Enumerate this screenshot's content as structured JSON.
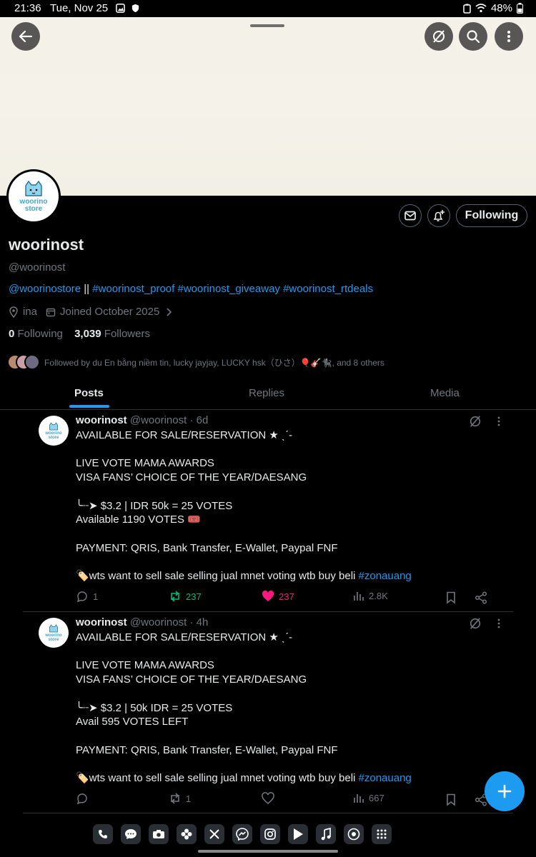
{
  "status_bar": {
    "time": "21:36",
    "date": "Tue, Nov 25",
    "battery": "48%"
  },
  "profile": {
    "display_name": "woorinost",
    "handle": "@woorinost",
    "avatar_text": [
      "woorino",
      "store"
    ],
    "bio": {
      "link1": "@woorinostore",
      "sep": " || ",
      "link2": "#woorinost_proof",
      "link3": "#woorinost_giveaway",
      "link4": "#woorinost_rtdeals"
    },
    "location": "ina",
    "joined": "Joined October 2025",
    "following_count": "0",
    "following_label": "Following",
    "followers_count": "3,039",
    "followers_label": "Followers",
    "followed_by": "Followed by du En bằng niềm tin, lucky jayjay, LUCKY hsk（ひさ）🎈🎸🐈‍⬛, and 8 others",
    "follow_button": "Following"
  },
  "tabs": [
    "Posts",
    "Replies",
    "Media"
  ],
  "posts": [
    {
      "name": "woorinost",
      "handle": "@woorinost",
      "time": "· 6d",
      "body": "AVAILABLE FOR SALE/RESERVATION ★ ˎˊ-\n\nLIVE VOTE MAMA AWARDS\nVISA FANS’ CHOICE OF THE YEAR/DAESANG\n\n╰┈➤ $3.2 | IDR 50k = 25 VOTES\nAvailable 1190 VOTES 🎟️\n\nPAYMENT: QRIS, Bank Transfer, E-Wallet, Paypal FNF\n\n🏷️wts want to sell sale selling jual mnet voting wtb buy beli ",
      "hashtag": "#zonauang",
      "replies": "1",
      "reposts": "237",
      "likes": "237",
      "views": "2.8K"
    },
    {
      "name": "woorinost",
      "handle": "@woorinost",
      "time": "· 4h",
      "body": "AVAILABLE FOR SALE/RESERVATION ★ ˎˊ-\n\nLIVE VOTE MAMA AWARDS\nVISA FANS’ CHOICE OF THE YEAR/DAESANG\n\n╰┈➤ $3.2 | 50k IDR = 25 VOTES\nAvail 595 VOTES LEFT\n\nPAYMENT: QRIS, Bank Transfer, E-Wallet, Paypal FNF\n\n🏷️wts want to sell sale selling jual mnet voting wtb buy beli ",
      "hashtag": "#zonauang",
      "replies": "",
      "reposts": "1",
      "likes": "",
      "views": "667"
    }
  ],
  "colors": {
    "accent": "#1d9bf0",
    "like": "#f91880",
    "repost": "#00ba7c",
    "muted": "#71767b"
  },
  "dock_apps": [
    "phone-icon",
    "messages-icon",
    "camera-icon",
    "gallery-icon",
    "x-icon",
    "messenger-icon",
    "instagram-icon",
    "play-store-icon",
    "music-icon",
    "chrome-icon",
    "apps-grid-icon"
  ]
}
